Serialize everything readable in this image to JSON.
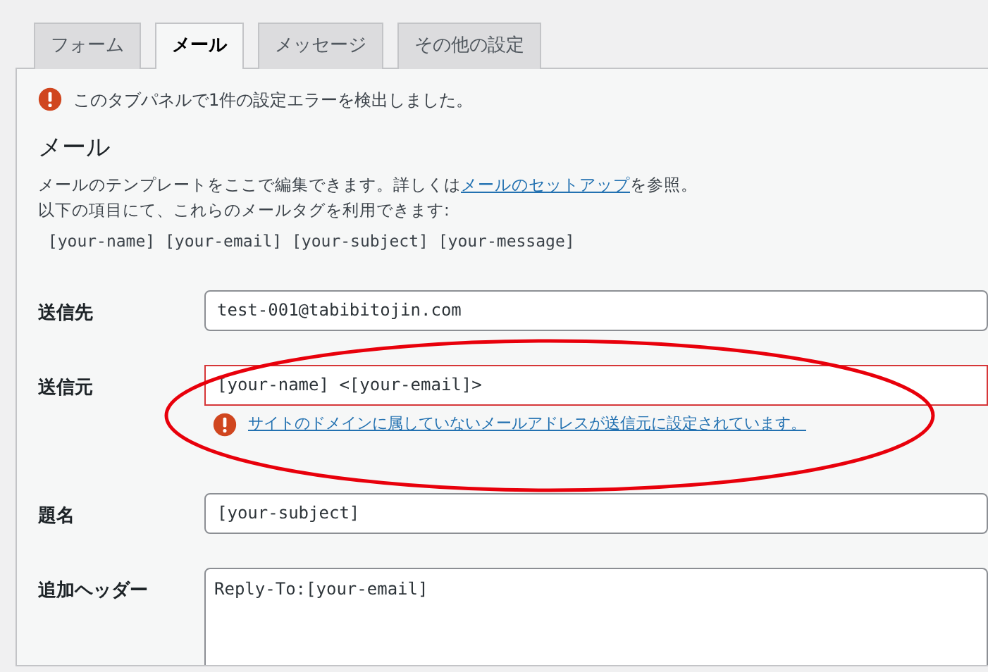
{
  "tabs": [
    {
      "label": "フォーム",
      "selected": false
    },
    {
      "label": "メール",
      "selected": true
    },
    {
      "label": "メッセージ",
      "selected": false
    },
    {
      "label": "その他の設定",
      "selected": false
    }
  ],
  "notice": {
    "text": "このタブパネルで1件の設定エラーを検出しました。"
  },
  "section": {
    "heading": "メール",
    "description_before": "メールのテンプレートをここで編集できます。詳しくは",
    "description_link": "メールのセットアップ",
    "description_after": "を参照。",
    "tags_intro": "以下の項目にて、これらのメールタグを利用できます:",
    "tags": " [your-name] [your-email] [your-subject] [your-message]"
  },
  "fields": [
    {
      "label": "送信先",
      "kind": "input",
      "value": "test-001@tabibitojin.com",
      "invalid": false
    },
    {
      "label": "送信元",
      "kind": "input",
      "value": "[your-name] <[your-email]>",
      "invalid": true,
      "error": "サイトのドメインに属していないメールアドレスが送信元に設定されています。"
    },
    {
      "label": "題名",
      "kind": "input",
      "value": "[your-subject]",
      "invalid": false
    },
    {
      "label": "追加ヘッダー",
      "kind": "textarea",
      "value": "Reply-To:[your-email]",
      "invalid": false
    }
  ]
}
